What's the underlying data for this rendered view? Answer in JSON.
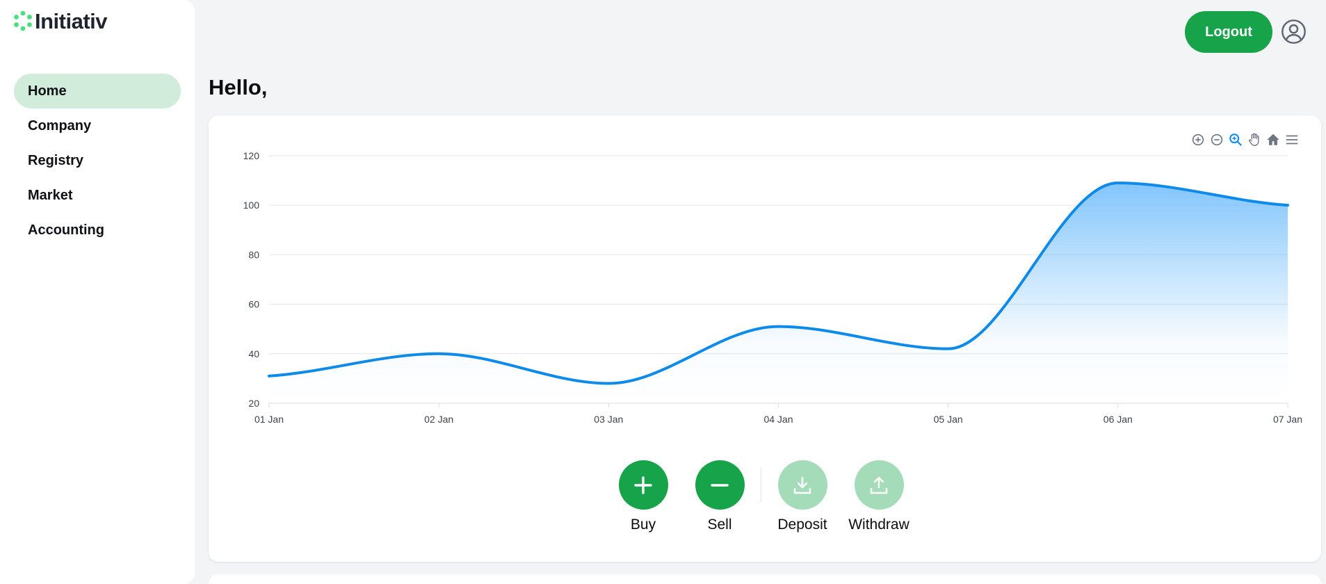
{
  "brand": {
    "name": "Initiativ",
    "accent": "#16a34a",
    "accent_light": "#d1ecdb",
    "logo_color": "#4ade80"
  },
  "sidebar": {
    "items": [
      {
        "label": "Home",
        "active": true
      },
      {
        "label": "Company",
        "active": false
      },
      {
        "label": "Registry",
        "active": false
      },
      {
        "label": "Market",
        "active": false
      },
      {
        "label": "Accounting",
        "active": false
      }
    ]
  },
  "header": {
    "logout_label": "Logout",
    "avatar_icon": "user-circle-icon"
  },
  "greeting": "Hello,",
  "toolbar": {
    "icons": [
      "zoom-in-icon",
      "zoom-out-icon",
      "selection-zoom-icon",
      "pan-icon",
      "reset-home-icon",
      "menu-icon"
    ]
  },
  "chart_data": {
    "type": "area",
    "categories": [
      "01 Jan",
      "02 Jan",
      "03 Jan",
      "04 Jan",
      "05 Jan",
      "06 Jan",
      "07 Jan"
    ],
    "series": [
      {
        "values": [
          31,
          40,
          28,
          51,
          42,
          109,
          100
        ]
      }
    ],
    "ylim": [
      20,
      120
    ],
    "yticks": [
      20,
      40,
      60,
      80,
      100,
      120
    ],
    "grid": true,
    "line_color": "#0e8ae9",
    "fill_color": "#7cc2fb",
    "curve": "smooth"
  },
  "actions": {
    "buy_label": "Buy",
    "sell_label": "Sell",
    "deposit_label": "Deposit",
    "withdraw_label": "Withdraw"
  }
}
